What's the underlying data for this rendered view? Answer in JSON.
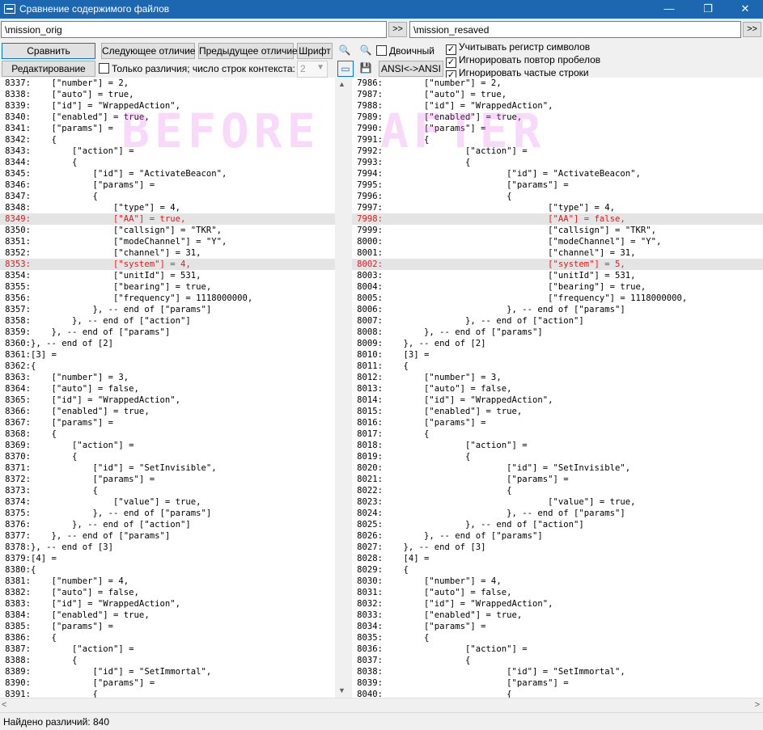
{
  "window": {
    "title": "Сравнение содержимого файлов",
    "controls": {
      "minimize": "—",
      "maximize": "❐",
      "close": "✕"
    }
  },
  "paths": {
    "left": "\\mission_orig",
    "right": "\\mission_resaved",
    "go_label": ">>"
  },
  "toolbar": {
    "compare": "Сравнить",
    "next_diff": "Следующее отличие",
    "prev_diff": "Предыдущее отличие",
    "font": "Шрифт",
    "binary_label": "Двоичный",
    "edit": "Редактирование",
    "only_diff_label": "Только различия; число строк контекста:",
    "context_lines": "2",
    "ansi": "ANSI<->ANSI",
    "icons": {
      "find": "🔍",
      "find_next": "🔍",
      "view": "▭",
      "save": "💾"
    }
  },
  "options": {
    "match_case": {
      "label": "Учитывать регистр символов",
      "checked": true
    },
    "ignore_spaces": {
      "label": "Игнорировать повтор пробелов",
      "checked": true
    },
    "ignore_frequent": {
      "label": "Игнорировать частые строки",
      "checked": true
    },
    "binary_checked": false,
    "only_diff_checked": false
  },
  "watermark": {
    "left": "BEFORE",
    "right": "AFTER"
  },
  "left_pane": {
    "lines": [
      {
        "n": "8337:",
        "t": "    [\"number\"] = 2,",
        "d": false
      },
      {
        "n": "8338:",
        "t": "    [\"auto\"] = true,",
        "d": false
      },
      {
        "n": "8339:",
        "t": "    [\"id\"] = \"WrappedAction\",",
        "d": false
      },
      {
        "n": "8340:",
        "t": "    [\"enabled\"] = true,",
        "d": false
      },
      {
        "n": "8341:",
        "t": "    [\"params\"] =",
        "d": false
      },
      {
        "n": "8342:",
        "t": "    {",
        "d": false
      },
      {
        "n": "8343:",
        "t": "        [\"action\"] =",
        "d": false
      },
      {
        "n": "8344:",
        "t": "        {",
        "d": false
      },
      {
        "n": "8345:",
        "t": "            [\"id\"] = \"ActivateBeacon\",",
        "d": false
      },
      {
        "n": "8346:",
        "t": "            [\"params\"] =",
        "d": false
      },
      {
        "n": "8347:",
        "t": "            {",
        "d": false
      },
      {
        "n": "8348:",
        "t": "                [\"type\"] = 4,",
        "d": false
      },
      {
        "n": "8349:",
        "t": "                [\"AA\"] = true,",
        "d": true
      },
      {
        "n": "8350:",
        "t": "                [\"callsign\"] = \"TKR\",",
        "d": false
      },
      {
        "n": "8351:",
        "t": "                [\"modeChannel\"] = \"Y\",",
        "d": false
      },
      {
        "n": "8352:",
        "t": "                [\"channel\"] = 31,",
        "d": false
      },
      {
        "n": "8353:",
        "t": "                [\"system\"] = 4,",
        "d": true
      },
      {
        "n": "8354:",
        "t": "                [\"unitId\"] = 531,",
        "d": false
      },
      {
        "n": "8355:",
        "t": "                [\"bearing\"] = true,",
        "d": false
      },
      {
        "n": "8356:",
        "t": "                [\"frequency\"] = 1118000000,",
        "d": false
      },
      {
        "n": "8357:",
        "t": "            }, -- end of [\"params\"]",
        "d": false
      },
      {
        "n": "8358:",
        "t": "        }, -- end of [\"action\"]",
        "d": false
      },
      {
        "n": "8359:",
        "t": "    }, -- end of [\"params\"]",
        "d": false
      },
      {
        "n": "8360:",
        "t": "}, -- end of [2]",
        "d": false
      },
      {
        "n": "8361:",
        "t": "[3] =",
        "d": false
      },
      {
        "n": "8362:",
        "t": "{",
        "d": false
      },
      {
        "n": "8363:",
        "t": "    [\"number\"] = 3,",
        "d": false
      },
      {
        "n": "8364:",
        "t": "    [\"auto\"] = false,",
        "d": false
      },
      {
        "n": "8365:",
        "t": "    [\"id\"] = \"WrappedAction\",",
        "d": false
      },
      {
        "n": "8366:",
        "t": "    [\"enabled\"] = true,",
        "d": false
      },
      {
        "n": "8367:",
        "t": "    [\"params\"] =",
        "d": false
      },
      {
        "n": "8368:",
        "t": "    {",
        "d": false
      },
      {
        "n": "8369:",
        "t": "        [\"action\"] =",
        "d": false
      },
      {
        "n": "8370:",
        "t": "        {",
        "d": false
      },
      {
        "n": "8371:",
        "t": "            [\"id\"] = \"SetInvisible\",",
        "d": false
      },
      {
        "n": "8372:",
        "t": "            [\"params\"] =",
        "d": false
      },
      {
        "n": "8373:",
        "t": "            {",
        "d": false
      },
      {
        "n": "8374:",
        "t": "                [\"value\"] = true,",
        "d": false
      },
      {
        "n": "8375:",
        "t": "            }, -- end of [\"params\"]",
        "d": false
      },
      {
        "n": "8376:",
        "t": "        }, -- end of [\"action\"]",
        "d": false
      },
      {
        "n": "8377:",
        "t": "    }, -- end of [\"params\"]",
        "d": false
      },
      {
        "n": "8378:",
        "t": "}, -- end of [3]",
        "d": false
      },
      {
        "n": "8379:",
        "t": "[4] =",
        "d": false
      },
      {
        "n": "8380:",
        "t": "{",
        "d": false
      },
      {
        "n": "8381:",
        "t": "    [\"number\"] = 4,",
        "d": false
      },
      {
        "n": "8382:",
        "t": "    [\"auto\"] = false,",
        "d": false
      },
      {
        "n": "8383:",
        "t": "    [\"id\"] = \"WrappedAction\",",
        "d": false
      },
      {
        "n": "8384:",
        "t": "    [\"enabled\"] = true,",
        "d": false
      },
      {
        "n": "8385:",
        "t": "    [\"params\"] =",
        "d": false
      },
      {
        "n": "8386:",
        "t": "    {",
        "d": false
      },
      {
        "n": "8387:",
        "t": "        [\"action\"] =",
        "d": false
      },
      {
        "n": "8388:",
        "t": "        {",
        "d": false
      },
      {
        "n": "8389:",
        "t": "            [\"id\"] = \"SetImmortal\",",
        "d": false
      },
      {
        "n": "8390:",
        "t": "            [\"params\"] =",
        "d": false
      },
      {
        "n": "8391:",
        "t": "            {",
        "d": false
      }
    ]
  },
  "right_pane": {
    "lines": [
      {
        "n": "7986:",
        "t": "        [\"number\"] = 2,",
        "d": false
      },
      {
        "n": "7987:",
        "t": "        [\"auto\"] = true,",
        "d": false
      },
      {
        "n": "7988:",
        "t": "        [\"id\"] = \"WrappedAction\",",
        "d": false
      },
      {
        "n": "7989:",
        "t": "        [\"enabled\"] = true,",
        "d": false
      },
      {
        "n": "7990:",
        "t": "        [\"params\"] =",
        "d": false
      },
      {
        "n": "7991:",
        "t": "        {",
        "d": false
      },
      {
        "n": "7992:",
        "t": "                [\"action\"] =",
        "d": false
      },
      {
        "n": "7993:",
        "t": "                {",
        "d": false
      },
      {
        "n": "7994:",
        "t": "                        [\"id\"] = \"ActivateBeacon\",",
        "d": false
      },
      {
        "n": "7995:",
        "t": "                        [\"params\"] =",
        "d": false
      },
      {
        "n": "7996:",
        "t": "                        {",
        "d": false
      },
      {
        "n": "7997:",
        "t": "                                [\"type\"] = 4,",
        "d": false
      },
      {
        "n": "7998:",
        "t": "                                [\"AA\"] = false,",
        "d": true
      },
      {
        "n": "7999:",
        "t": "                                [\"callsign\"] = \"TKR\",",
        "d": false
      },
      {
        "n": "8000:",
        "t": "                                [\"modeChannel\"] = \"Y\",",
        "d": false
      },
      {
        "n": "8001:",
        "t": "                                [\"channel\"] = 31,",
        "d": false
      },
      {
        "n": "8002:",
        "t": "                                [\"system\"] = 5,",
        "d": true
      },
      {
        "n": "8003:",
        "t": "                                [\"unitId\"] = 531,",
        "d": false
      },
      {
        "n": "8004:",
        "t": "                                [\"bearing\"] = true,",
        "d": false
      },
      {
        "n": "8005:",
        "t": "                                [\"frequency\"] = 1118000000,",
        "d": false
      },
      {
        "n": "8006:",
        "t": "                        }, -- end of [\"params\"]",
        "d": false
      },
      {
        "n": "8007:",
        "t": "                }, -- end of [\"action\"]",
        "d": false
      },
      {
        "n": "8008:",
        "t": "        }, -- end of [\"params\"]",
        "d": false
      },
      {
        "n": "8009:",
        "t": "    }, -- end of [2]",
        "d": false
      },
      {
        "n": "8010:",
        "t": "    [3] =",
        "d": false
      },
      {
        "n": "8011:",
        "t": "    {",
        "d": false
      },
      {
        "n": "8012:",
        "t": "        [\"number\"] = 3,",
        "d": false
      },
      {
        "n": "8013:",
        "t": "        [\"auto\"] = false,",
        "d": false
      },
      {
        "n": "8014:",
        "t": "        [\"id\"] = \"WrappedAction\",",
        "d": false
      },
      {
        "n": "8015:",
        "t": "        [\"enabled\"] = true,",
        "d": false
      },
      {
        "n": "8016:",
        "t": "        [\"params\"] =",
        "d": false
      },
      {
        "n": "8017:",
        "t": "        {",
        "d": false
      },
      {
        "n": "8018:",
        "t": "                [\"action\"] =",
        "d": false
      },
      {
        "n": "8019:",
        "t": "                {",
        "d": false
      },
      {
        "n": "8020:",
        "t": "                        [\"id\"] = \"SetInvisible\",",
        "d": false
      },
      {
        "n": "8021:",
        "t": "                        [\"params\"] =",
        "d": false
      },
      {
        "n": "8022:",
        "t": "                        {",
        "d": false
      },
      {
        "n": "8023:",
        "t": "                                [\"value\"] = true,",
        "d": false
      },
      {
        "n": "8024:",
        "t": "                        }, -- end of [\"params\"]",
        "d": false
      },
      {
        "n": "8025:",
        "t": "                }, -- end of [\"action\"]",
        "d": false
      },
      {
        "n": "8026:",
        "t": "        }, -- end of [\"params\"]",
        "d": false
      },
      {
        "n": "8027:",
        "t": "    }, -- end of [3]",
        "d": false
      },
      {
        "n": "8028:",
        "t": "    [4] =",
        "d": false
      },
      {
        "n": "8029:",
        "t": "    {",
        "d": false
      },
      {
        "n": "8030:",
        "t": "        [\"number\"] = 4,",
        "d": false
      },
      {
        "n": "8031:",
        "t": "        [\"auto\"] = false,",
        "d": false
      },
      {
        "n": "8032:",
        "t": "        [\"id\"] = \"WrappedAction\",",
        "d": false
      },
      {
        "n": "8033:",
        "t": "        [\"enabled\"] = true,",
        "d": false
      },
      {
        "n": "8034:",
        "t": "        [\"params\"] =",
        "d": false
      },
      {
        "n": "8035:",
        "t": "        {",
        "d": false
      },
      {
        "n": "8036:",
        "t": "                [\"action\"] =",
        "d": false
      },
      {
        "n": "8037:",
        "t": "                {",
        "d": false
      },
      {
        "n": "8038:",
        "t": "                        [\"id\"] = \"SetImmortal\",",
        "d": false
      },
      {
        "n": "8039:",
        "t": "                        [\"params\"] =",
        "d": false
      },
      {
        "n": "8040:",
        "t": "                        {",
        "d": false
      }
    ]
  },
  "scroll": {
    "up": "▲",
    "down": "▼",
    "left": "<",
    "right": ">"
  },
  "status": {
    "text": "Найдено различий: 840"
  },
  "colors": {
    "titlebar": "#1d66b0",
    "diff_text": "#e81818",
    "diff_bg": "#e4e4e4"
  }
}
